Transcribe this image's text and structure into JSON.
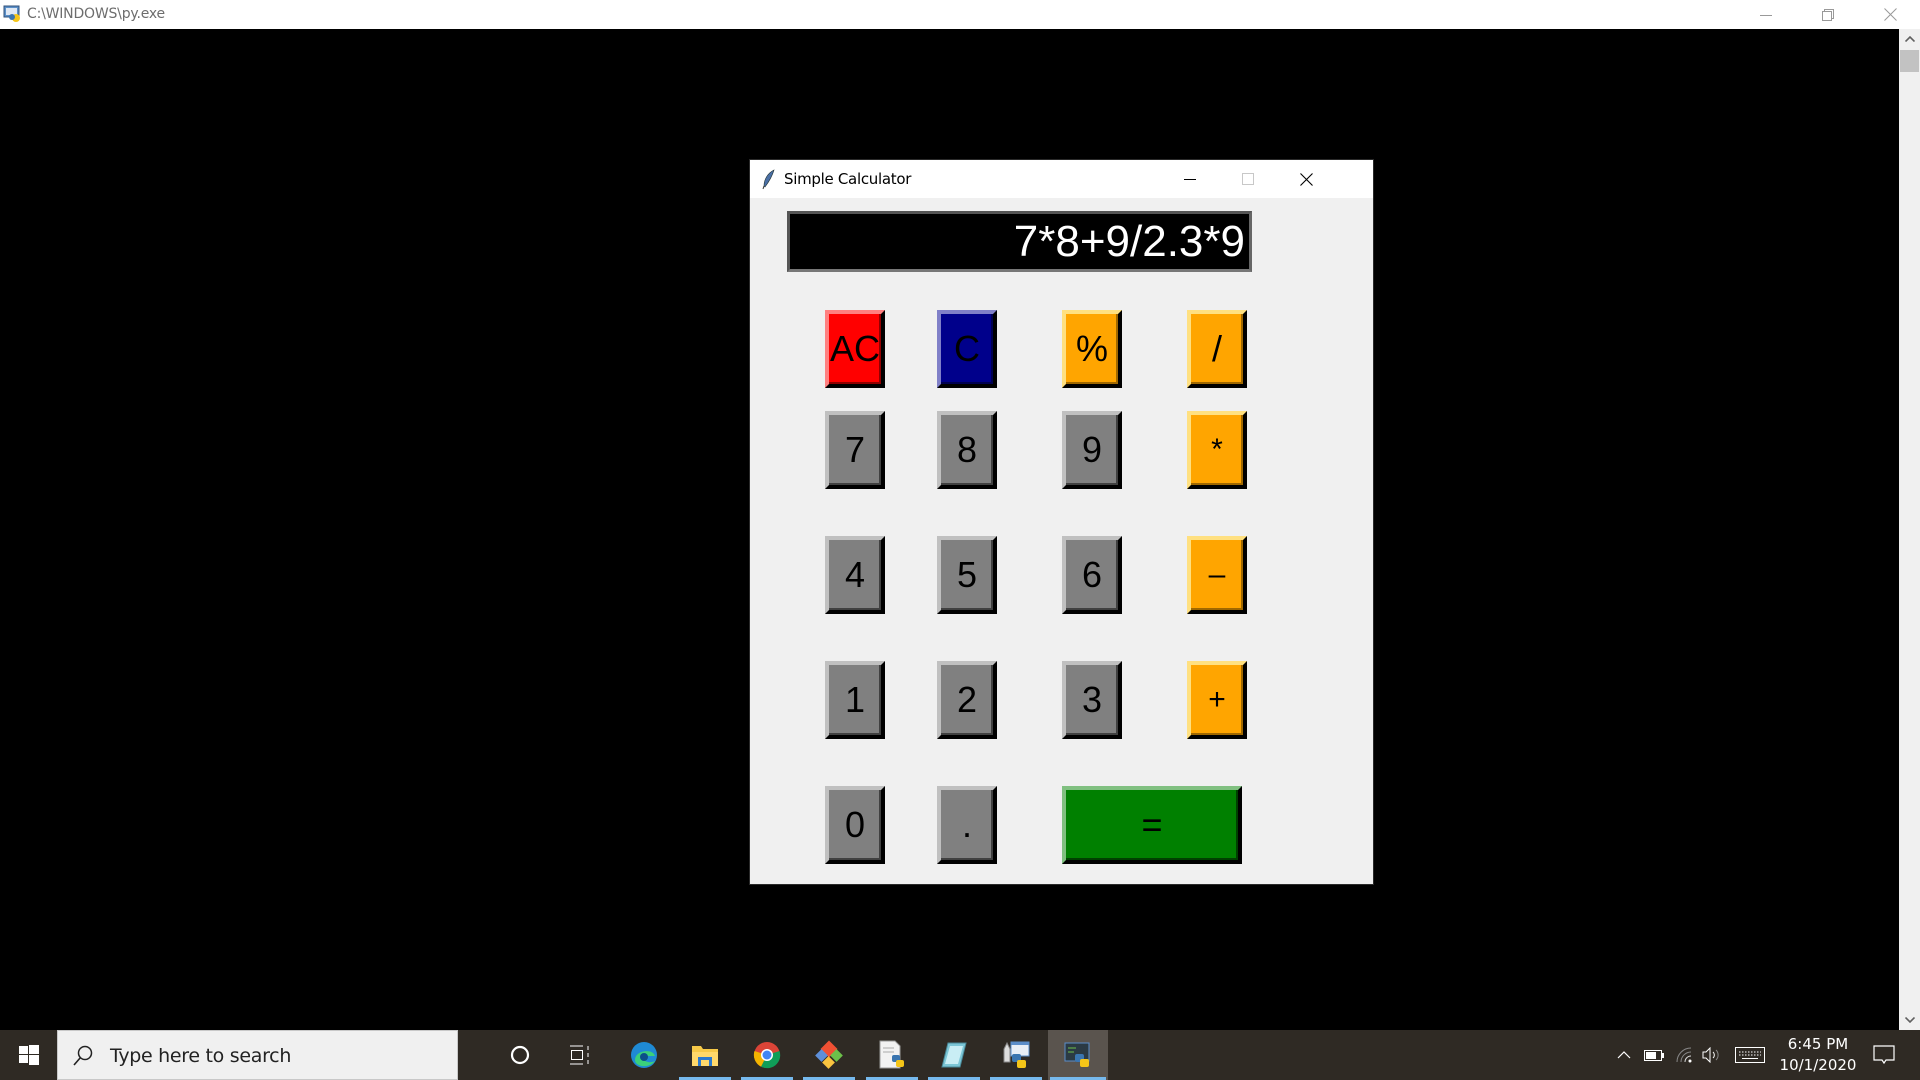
{
  "console": {
    "title": "C:\\WINDOWS\\py.exe",
    "icon": "python-console-icon",
    "controls": [
      "minimize",
      "restore",
      "close"
    ]
  },
  "calculator": {
    "title": "Simple Calculator",
    "icon": "tk-feather-icon",
    "display_value": "7*8+9/2.3*9",
    "colors": {
      "ac": "#ff0000",
      "clear": "#00008b",
      "operator": "#ffa500",
      "digit": "#808080",
      "equals": "#008000",
      "display_bg": "#000000",
      "display_fg": "#ffffff",
      "window_bg": "#f0f0f0"
    },
    "rows": [
      [
        {
          "label": "AC",
          "kind": "ac",
          "name": "all-clear-button"
        },
        {
          "label": "C",
          "kind": "c",
          "name": "clear-button"
        },
        {
          "label": "%",
          "kind": "op",
          "name": "percent-button"
        },
        {
          "label": "/",
          "kind": "op",
          "name": "divide-button"
        }
      ],
      [
        {
          "label": "7",
          "kind": "num",
          "name": "digit-7-button"
        },
        {
          "label": "8",
          "kind": "num",
          "name": "digit-8-button"
        },
        {
          "label": "9",
          "kind": "num",
          "name": "digit-9-button"
        },
        {
          "label": "*",
          "kind": "op",
          "name": "multiply-button"
        }
      ],
      [
        {
          "label": "4",
          "kind": "num",
          "name": "digit-4-button"
        },
        {
          "label": "5",
          "kind": "num",
          "name": "digit-5-button"
        },
        {
          "label": "6",
          "kind": "num",
          "name": "digit-6-button"
        },
        {
          "label": "–",
          "kind": "op",
          "name": "subtract-button"
        }
      ],
      [
        {
          "label": "1",
          "kind": "num",
          "name": "digit-1-button"
        },
        {
          "label": "2",
          "kind": "num",
          "name": "digit-2-button"
        },
        {
          "label": "3",
          "kind": "num",
          "name": "digit-3-button"
        },
        {
          "label": "+",
          "kind": "op",
          "name": "add-button"
        }
      ],
      [
        {
          "label": "0",
          "kind": "num",
          "name": "digit-0-button"
        },
        {
          "label": ".",
          "kind": "num",
          "name": "decimal-point-button"
        },
        {
          "label": "=",
          "kind": "eq",
          "name": "equals-button"
        }
      ]
    ]
  },
  "taskbar": {
    "search_placeholder": "Type here to search",
    "pinned": [
      {
        "name": "cortana-icon",
        "running": false
      },
      {
        "name": "task-view-icon",
        "running": false
      },
      {
        "name": "edge-icon",
        "running": false
      },
      {
        "name": "file-explorer-icon",
        "running": true
      },
      {
        "name": "chrome-icon",
        "running": true
      },
      {
        "name": "git-icon",
        "running": true
      },
      {
        "name": "python-file-icon",
        "running": true
      },
      {
        "name": "notepad-icon",
        "running": true
      },
      {
        "name": "python-launcher-icon",
        "running": true
      },
      {
        "name": "python-console-icon",
        "running": true,
        "active": true
      }
    ],
    "tray": [
      "show-hidden-icons",
      "battery-icon",
      "wifi-icon",
      "volume-icon",
      "touch-keyboard-icon"
    ],
    "time": "6:45 PM",
    "date": "10/1/2020"
  }
}
